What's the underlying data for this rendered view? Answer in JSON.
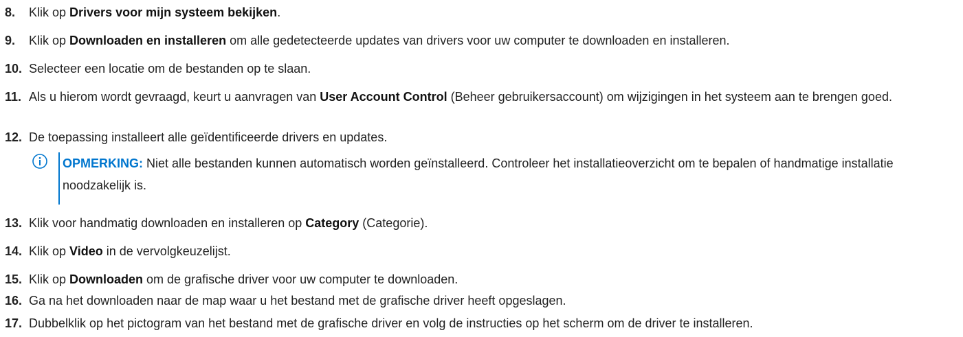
{
  "steps": [
    {
      "num": "8.",
      "pre": "Klik op ",
      "bold": "Drivers voor mijn systeem bekijken",
      "post": "."
    },
    {
      "num": "9.",
      "pre": "Klik op ",
      "bold": "Downloaden en installeren",
      "post": " om alle gedetecteerde updates van drivers voor uw computer te downloaden en installeren."
    },
    {
      "num": "10.",
      "pre": "Selecteer een locatie om de bestanden op te slaan.",
      "bold": "",
      "post": ""
    },
    {
      "num": "11.",
      "pre": "Als u hierom wordt gevraagd, keurt u aanvragen van ",
      "bold": "User Account Control",
      "post": " (Beheer gebruikersaccount) om wijzigingen in het systeem aan te brengen goed."
    },
    {
      "num": "12.",
      "pre": "De toepassing installeert alle geïdentificeerde drivers en updates.",
      "bold": "",
      "post": ""
    },
    {
      "num": "13.",
      "pre": "Klik voor handmatig downloaden en installeren op ",
      "bold": "Category",
      "post": " (Categorie)."
    },
    {
      "num": "14.",
      "pre": "Klik op ",
      "bold": "Video",
      "post": " in de vervolgkeuzelijst."
    },
    {
      "num": "15.",
      "pre": "Klik op ",
      "bold": "Downloaden",
      "post": " om de grafische driver voor uw computer te downloaden."
    },
    {
      "num": "16.",
      "pre": "Ga na het downloaden naar de map waar u het bestand met de grafische driver heeft opgeslagen.",
      "bold": "",
      "post": ""
    },
    {
      "num": "17.",
      "pre": "Dubbelklik op het pictogram van het bestand met de grafische driver en volg de instructies op het scherm om de driver te installeren.",
      "bold": "",
      "post": ""
    }
  ],
  "note": {
    "icon": "info-icon",
    "label": "OPMERKING:",
    "text": " Niet alle bestanden kunnen automatisch worden geïnstalleerd. Controleer het installatieoverzicht om te bepalen of handmatige installatie noodzakelijk is."
  },
  "colors": {
    "note_accent": "#0076ce",
    "text": "#222222"
  }
}
